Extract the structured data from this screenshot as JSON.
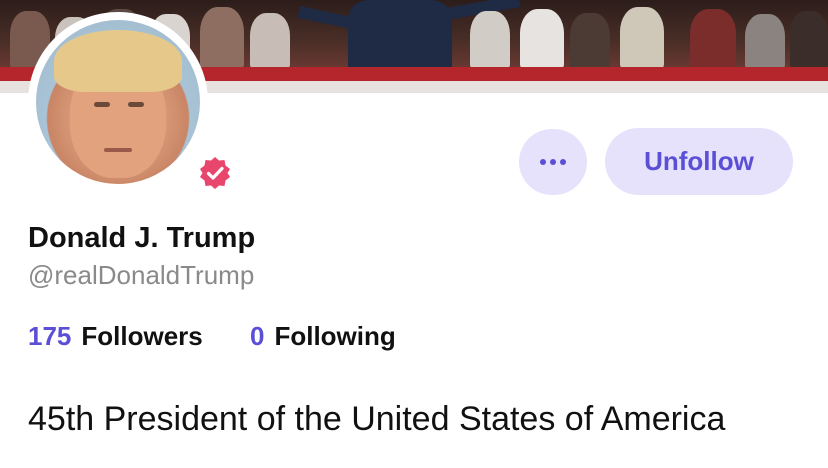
{
  "profile": {
    "display_name": "Donald J. Trump",
    "handle": "@realDonaldTrump",
    "verified_icon": "verified-badge-icon",
    "bio": "45th President of the United States of America"
  },
  "stats": {
    "followers_count": "175",
    "followers_label": "Followers",
    "following_count": "0",
    "following_label": "Following"
  },
  "actions": {
    "more_icon": "ellipsis-icon",
    "unfollow_label": "Unfollow"
  },
  "colors": {
    "accent": "#5b4fd6",
    "button_bg": "#e6e2fb",
    "verified_badge": "#e9466e",
    "secondary_text": "#8a8a8a"
  }
}
